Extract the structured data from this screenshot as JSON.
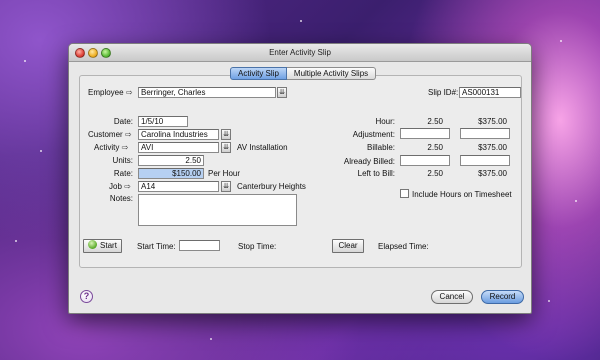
{
  "window": {
    "title": "Enter Activity Slip"
  },
  "tabs": [
    "Activity Slip",
    "Multiple Activity Slips"
  ],
  "employee": {
    "label": "Employee",
    "value": "Berringer, Charles"
  },
  "slip_id": {
    "label": "Slip ID#:",
    "value": "AS000131"
  },
  "date": {
    "label": "Date:",
    "value": "1/5/10"
  },
  "customer": {
    "label": "Customer",
    "value": "Carolina Industries"
  },
  "activity": {
    "label": "Activity",
    "value": "AVI",
    "description": "AV Installation"
  },
  "units": {
    "label": "Units:",
    "value": "2.50"
  },
  "rate": {
    "label": "Rate:",
    "value": "$150.00",
    "unit": "Per Hour"
  },
  "job": {
    "label": "Job",
    "value": "A14",
    "description": "Canterbury Heights"
  },
  "notes": {
    "label": "Notes:",
    "value": ""
  },
  "summary": {
    "hour": {
      "label": "Hour:",
      "units": "2.50",
      "amount": "$375.00"
    },
    "adjustment": {
      "label": "Adjustment:",
      "units": "",
      "amount": ""
    },
    "billable": {
      "label": "Billable:",
      "units": "2.50",
      "amount": "$375.00"
    },
    "already_billed": {
      "label": "Already Billed:",
      "units": "",
      "amount": ""
    },
    "left_to_bill": {
      "label": "Left to Bill:",
      "units": "2.50",
      "amount": "$375.00"
    }
  },
  "include_hours": {
    "label": "Include Hours on Timesheet",
    "checked": false
  },
  "timer": {
    "start_label": "Start",
    "start_time_label": "Start Time:",
    "start_time_value": "",
    "stop_time_label": "Stop Time:",
    "clear_label": "Clear",
    "elapsed_label": "Elapsed Time:"
  },
  "footer": {
    "help_icon": "?",
    "cancel_label": "Cancel",
    "record_label": "Record"
  },
  "icons": {
    "lookup_arrow": "⇨",
    "dropdown": "⇊"
  }
}
